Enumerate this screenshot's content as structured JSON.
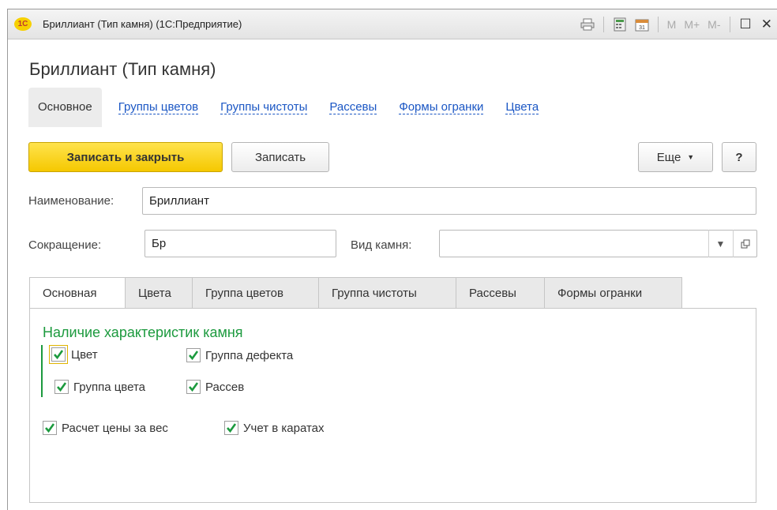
{
  "window": {
    "title": "Бриллиант (Тип камня)  (1С:Предприятие)",
    "logo_text": "1С",
    "memory_buttons": [
      "M",
      "M+",
      "M-"
    ],
    "icons": [
      "print-icon",
      "calculator-icon",
      "calendar-icon",
      "maximize-icon",
      "close-icon"
    ]
  },
  "form": {
    "title": "Бриллиант (Тип камня)"
  },
  "nav": {
    "items": [
      {
        "label": "Основное"
      },
      {
        "label": "Группы цветов"
      },
      {
        "label": "Группы чистоты"
      },
      {
        "label": "Рассевы"
      },
      {
        "label": "Формы огранки"
      },
      {
        "label": "Цвета"
      }
    ]
  },
  "toolbar": {
    "save_close_label": "Записать и закрыть",
    "save_label": "Записать",
    "more_label": "Еще",
    "help_label": "?"
  },
  "fields": {
    "name_label": "Наименование:",
    "name_value": "Бриллиант",
    "short_label": "Сокращение:",
    "short_value": "Бр",
    "kind_label": "Вид камня:",
    "kind_value": ""
  },
  "tabs": [
    {
      "label": "Основная"
    },
    {
      "label": "Цвета"
    },
    {
      "label": "Группа цветов"
    },
    {
      "label": "Группа чистоты"
    },
    {
      "label": "Рассевы"
    },
    {
      "label": "Формы огранки"
    }
  ],
  "panel": {
    "group_title": "Наличие характеристик камня",
    "checkboxes": [
      {
        "label": "Цвет",
        "checked": true
      },
      {
        "label": "Группа дефекта",
        "checked": true
      },
      {
        "label": "Группа цвета",
        "checked": true
      },
      {
        "label": "Рассев",
        "checked": true
      },
      {
        "label": "Расчет цены за вес",
        "checked": true
      },
      {
        "label": "Учет в каратах",
        "checked": true
      }
    ]
  },
  "colors": {
    "accent_green": "#1c9a3e",
    "primary_button": "#f5c800",
    "link": "#1a56c4"
  }
}
